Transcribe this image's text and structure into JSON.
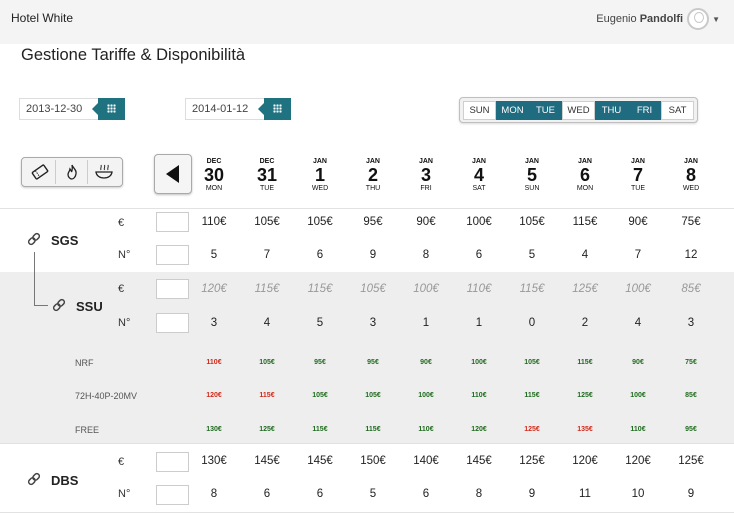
{
  "app": {
    "title": "Hotel White",
    "user_first": "Eugenio",
    "user_last": "Pandolfi"
  },
  "page_title": "Gestione Tariffe & Disponibilità",
  "date_from": "2013-12-30",
  "date_to": "2014-01-12",
  "days_filter": [
    {
      "label": "SUN",
      "on": false
    },
    {
      "label": "MON",
      "on": true
    },
    {
      "label": "TUE",
      "on": true
    },
    {
      "label": "WED",
      "on": false
    },
    {
      "label": "THU",
      "on": true
    },
    {
      "label": "FRI",
      "on": true
    },
    {
      "label": "SAT",
      "on": false
    }
  ],
  "tools": [
    "ticket-icon",
    "flame-icon",
    "food-bowl-icon"
  ],
  "dates": [
    {
      "mon": "DEC",
      "day": "30",
      "dow": "MON"
    },
    {
      "mon": "DEC",
      "day": "31",
      "dow": "TUE"
    },
    {
      "mon": "JAN",
      "day": "1",
      "dow": "WED"
    },
    {
      "mon": "JAN",
      "day": "2",
      "dow": "THU"
    },
    {
      "mon": "JAN",
      "day": "3",
      "dow": "FRI"
    },
    {
      "mon": "JAN",
      "day": "4",
      "dow": "SAT"
    },
    {
      "mon": "JAN",
      "day": "5",
      "dow": "SUN"
    },
    {
      "mon": "JAN",
      "day": "6",
      "dow": "MON"
    },
    {
      "mon": "JAN",
      "day": "7",
      "dow": "TUE"
    },
    {
      "mon": "JAN",
      "day": "8",
      "dow": "WED"
    }
  ],
  "labels": {
    "price": "€",
    "qty": "N°"
  },
  "colors": {
    "accent": "#1f6b80",
    "good": "#1f6b1f",
    "bad": "#d12a1a"
  },
  "rooms": {
    "sgs": {
      "name": "SGS",
      "prices": [
        "110€",
        "105€",
        "105€",
        "95€",
        "90€",
        "100€",
        "105€",
        "115€",
        "90€",
        "75€"
      ],
      "qty": [
        "5",
        "7",
        "6",
        "9",
        "8",
        "6",
        "5",
        "4",
        "7",
        "12"
      ]
    },
    "ssu": {
      "name": "SSU",
      "prices": [
        "120€",
        "115€",
        "115€",
        "105€",
        "100€",
        "110€",
        "115€",
        "125€",
        "100€",
        "85€"
      ],
      "qty": [
        "3",
        "4",
        "5",
        "3",
        "1",
        "1",
        "0",
        "2",
        "4",
        "3"
      ]
    },
    "dbs": {
      "name": "DBS",
      "prices": [
        "130€",
        "145€",
        "145€",
        "150€",
        "140€",
        "145€",
        "125€",
        "120€",
        "120€",
        "125€"
      ],
      "qty": [
        "8",
        "6",
        "6",
        "5",
        "6",
        "8",
        "9",
        "11",
        "10",
        "9"
      ]
    }
  },
  "rate_plans": [
    {
      "name": "NRF",
      "values": [
        "110€",
        "105€",
        "95€",
        "95€",
        "90€",
        "100€",
        "105€",
        "115€",
        "90€",
        "75€"
      ],
      "status": [
        "bad",
        "good",
        "good",
        "good",
        "good",
        "good",
        "good",
        "good",
        "good",
        "good"
      ]
    },
    {
      "name": "72H-40P-20MV",
      "values": [
        "120€",
        "115€",
        "105€",
        "105€",
        "100€",
        "110€",
        "115€",
        "125€",
        "100€",
        "85€"
      ],
      "status": [
        "bad",
        "bad",
        "good",
        "good",
        "good",
        "good",
        "good",
        "good",
        "good",
        "good"
      ]
    },
    {
      "name": "FREE",
      "values": [
        "130€",
        "125€",
        "115€",
        "115€",
        "110€",
        "120€",
        "125€",
        "135€",
        "110€",
        "95€"
      ],
      "status": [
        "good",
        "good",
        "good",
        "good",
        "good",
        "good",
        "bad",
        "bad",
        "good",
        "good"
      ]
    }
  ]
}
